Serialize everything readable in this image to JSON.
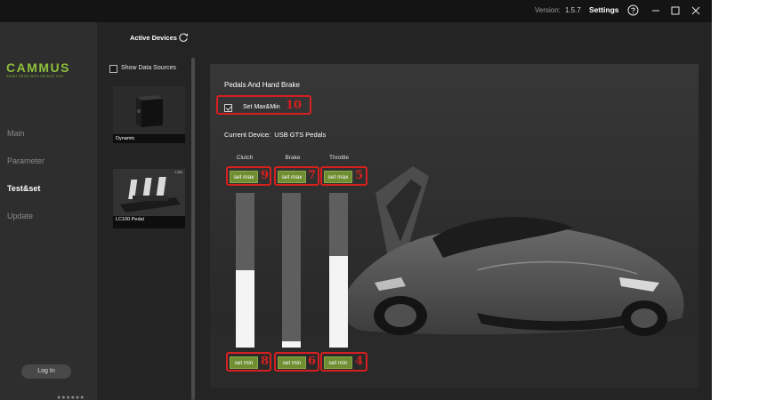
{
  "titlebar": {
    "version_label": "Version:",
    "version_value": "1.5.7",
    "settings_label": "Settings"
  },
  "sidebar": {
    "logo_text": "CAMMUS",
    "logo_tagline": "SMART DRIVE WITH INFINITE FUN",
    "items": [
      {
        "label": "Main"
      },
      {
        "label": "Parameter"
      },
      {
        "label": "Test&set"
      },
      {
        "label": "Update"
      }
    ],
    "active_item": "Test&set",
    "login_label": "Log In",
    "pager_dots": "●●●●●●"
  },
  "devices": {
    "title": "Active Devices",
    "show_sources_label": "Show Data Sources",
    "list": [
      {
        "name": "Dynamic"
      },
      {
        "name": "LC100 Pedal",
        "thumb_text": "1:253"
      }
    ]
  },
  "panel": {
    "title": "Pedals And Hand Brake",
    "set_maxmin_label": "Set Max&Min",
    "set_maxmin_checked": true,
    "current_device_label": "Current Device:",
    "current_device_name": "USB GTS Pedals",
    "set_max_label": "set max",
    "set_min_label": "set min",
    "pedals": [
      {
        "name": "Clutch",
        "level": 0.5
      },
      {
        "name": "Brake",
        "level": 0.04
      },
      {
        "name": "Throttle",
        "level": 0.59
      }
    ]
  },
  "annotations": [
    "10",
    "9",
    "7",
    "5",
    "8",
    "6",
    "4"
  ],
  "colors": {
    "accent_green": "#6f8e32",
    "logo_green": "#8fbf3b",
    "annotation_red": "#d62020"
  }
}
